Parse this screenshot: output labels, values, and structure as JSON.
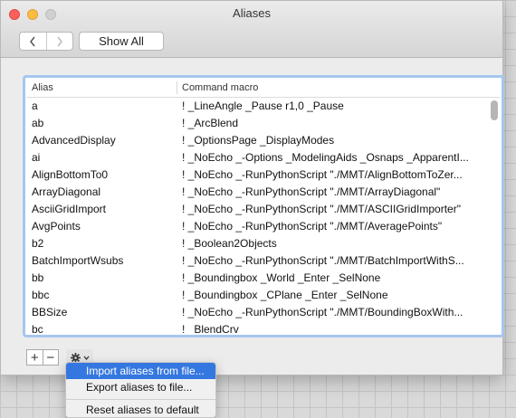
{
  "window": {
    "title": "Aliases"
  },
  "toolbar": {
    "back_icon": "chevron-left-icon",
    "forward_icon": "chevron-right-icon",
    "show_all_label": "Show All"
  },
  "table": {
    "columns": [
      "Alias",
      "Command macro"
    ],
    "rows": [
      {
        "alias": "a",
        "command": "! _LineAngle _Pause r1,0 _Pause"
      },
      {
        "alias": "ab",
        "command": "! _ArcBlend"
      },
      {
        "alias": "AdvancedDisplay",
        "command": "! _OptionsPage _DisplayModes"
      },
      {
        "alias": "ai",
        "command": "! _NoEcho _-Options _ModelingAids _Osnaps _ApparentI..."
      },
      {
        "alias": "AlignBottomTo0",
        "command": "! _NoEcho _-RunPythonScript \"./MMT/AlignBottomToZer..."
      },
      {
        "alias": "ArrayDiagonal",
        "command": "! _NoEcho _-RunPythonScript \"./MMT/ArrayDiagonal\""
      },
      {
        "alias": "AsciiGridImport",
        "command": "! _NoEcho _-RunPythonScript \"./MMT/ASCIIGridImporter\""
      },
      {
        "alias": "AvgPoints",
        "command": "! _NoEcho _-RunPythonScript \"./MMT/AveragePoints\""
      },
      {
        "alias": "b2",
        "command": "! _Boolean2Objects"
      },
      {
        "alias": "BatchImportWsubs",
        "command": "! _NoEcho _-RunPythonScript \"./MMT/BatchImportWithS..."
      },
      {
        "alias": "bb",
        "command": "! _Boundingbox _World _Enter _SelNone"
      },
      {
        "alias": "bbc",
        "command": "! _Boundingbox _CPlane _Enter _SelNone"
      },
      {
        "alias": "BBSize",
        "command": "! _NoEcho _-RunPythonScript \"./MMT/BoundingBoxWith..."
      },
      {
        "alias": "bc",
        "command": "! _BlendCrv"
      }
    ]
  },
  "bottom": {
    "plus_label": "+",
    "minus_label": "−",
    "gear_icon": "gear-icon",
    "chevron_icon": "chevron-down-icon"
  },
  "menu": {
    "items": [
      {
        "label": "Import aliases from file...",
        "selected": true
      },
      {
        "label": "Export aliases to file..."
      },
      {
        "label": "Reset aliases to default"
      }
    ]
  },
  "colors": {
    "accent": "#3577e0",
    "focus_ring": "#a6c6ee",
    "close": "#fc605b",
    "minimize": "#fdbc40"
  }
}
